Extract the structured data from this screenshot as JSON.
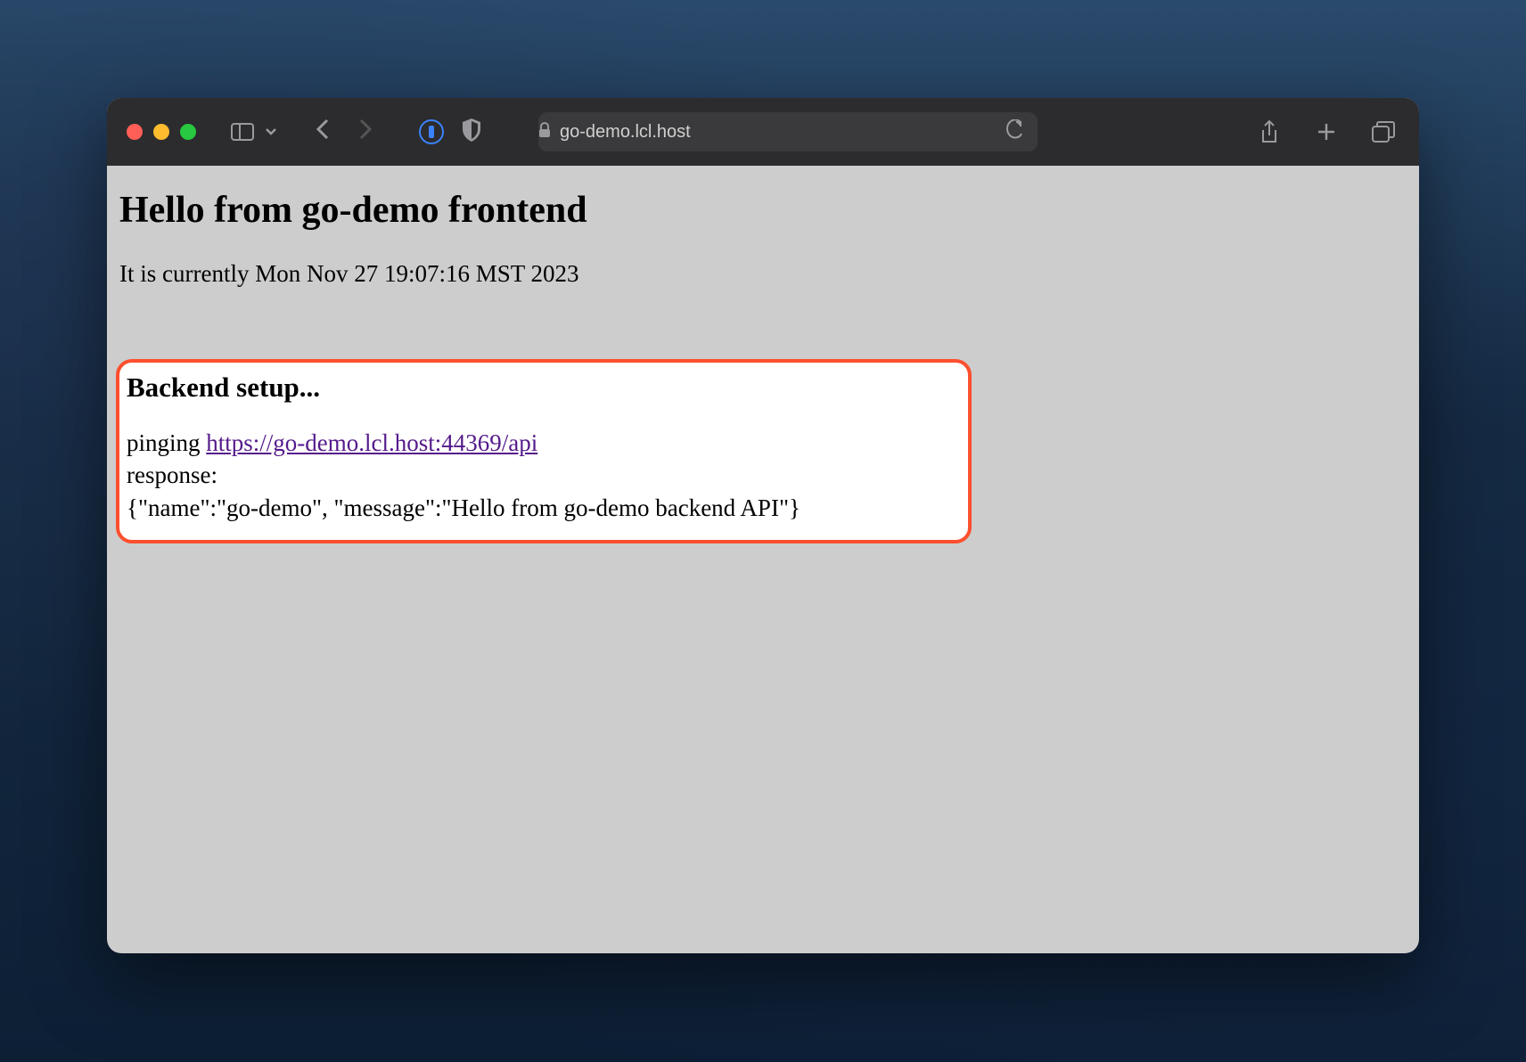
{
  "browser": {
    "url_host": "go-demo.lcl.host"
  },
  "page": {
    "title": "Hello from go-demo frontend",
    "timestamp_prefix": "It is currently ",
    "timestamp": "Mon Nov 27 19:07:16 MST 2023"
  },
  "backend": {
    "heading": "Backend setup...",
    "ping_prefix": "pinging ",
    "api_url": "https://go-demo.lcl.host:44369/api",
    "response_label": "response:",
    "response_body": "{\"name\":\"go-demo\", \"message\":\"Hello from go-demo backend API\"}"
  }
}
